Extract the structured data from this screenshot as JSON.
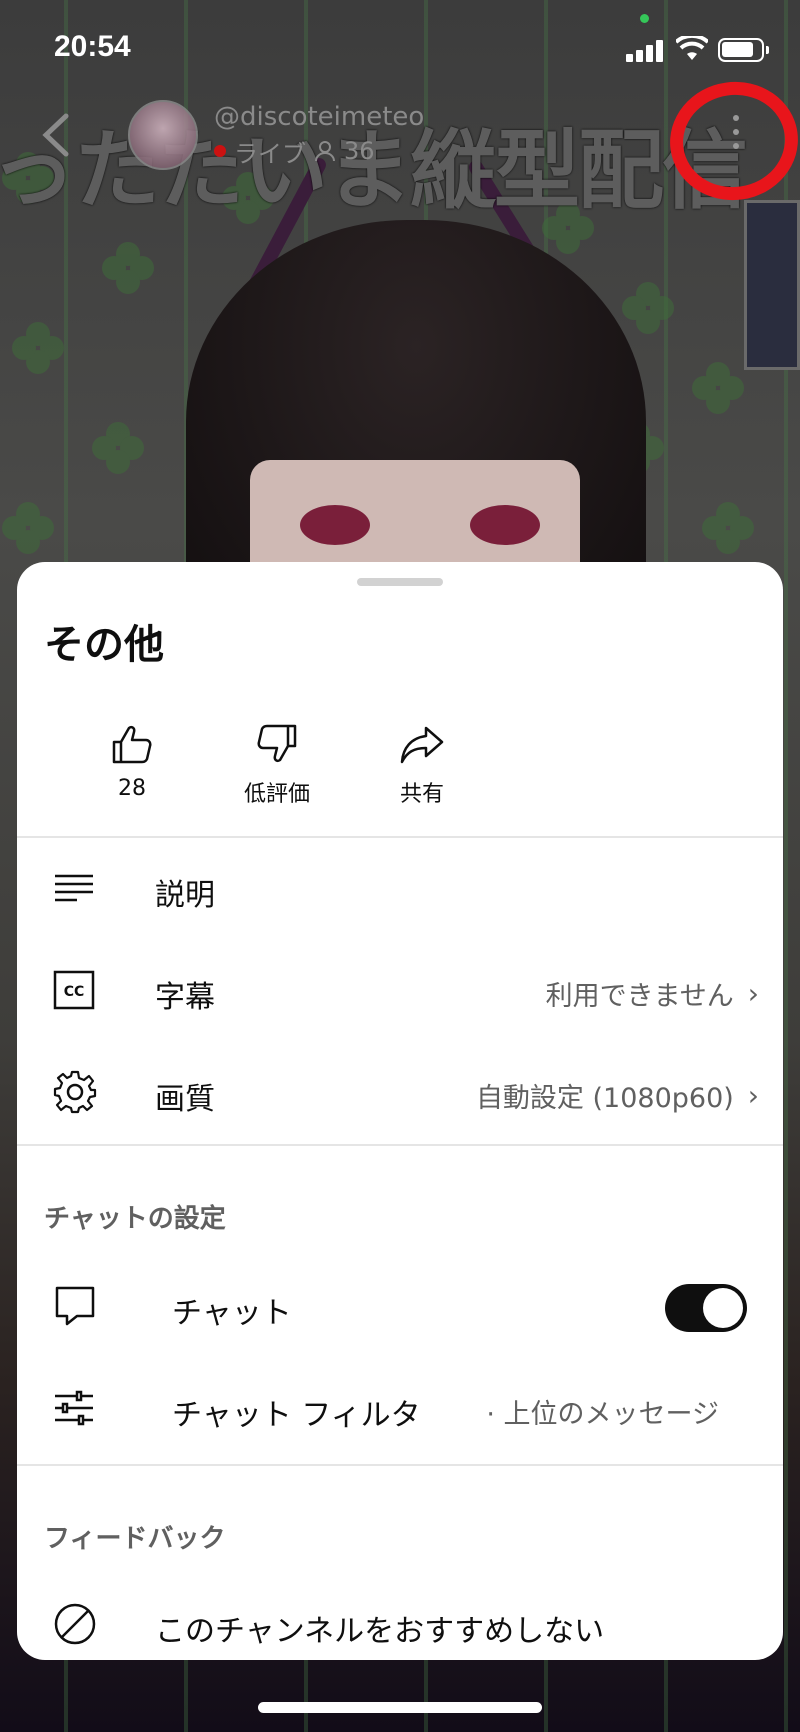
{
  "status_bar": {
    "time": "20:54",
    "battery_level": 0.85
  },
  "video": {
    "title_overlay": "ったたいま縦型配信"
  },
  "channel": {
    "handle": "@discoteimeteo",
    "live_label": "ライブ",
    "viewer_count": "36"
  },
  "sheet": {
    "title": "その他",
    "actions": [
      {
        "icon": "thumbs-up-icon",
        "label": "28"
      },
      {
        "icon": "thumbs-down-icon",
        "label": "低評価"
      },
      {
        "icon": "share-icon",
        "label": "共有"
      }
    ],
    "rows": [
      {
        "icon": "description-icon",
        "label": "説明",
        "value": ""
      },
      {
        "icon": "closed-captions-icon",
        "label": "字幕",
        "value": "利用できません"
      },
      {
        "icon": "gear-icon",
        "label": "画質",
        "value": "自動設定 (1080p60)"
      }
    ],
    "chat_section": {
      "heading": "チャットの設定",
      "chat_label": "チャット",
      "chat_enabled": true,
      "filter_label": "チャット フィルタ",
      "filter_value": "· 上位のメッセージ"
    },
    "feedback_section": {
      "heading": "フィードバック",
      "dont_recommend_label": "このチャンネルをおすすめしない"
    }
  },
  "colors": {
    "annotation_circle": "#e8151b",
    "live_dot": "#cc1111",
    "toggle_on": "#0f0f0f"
  }
}
